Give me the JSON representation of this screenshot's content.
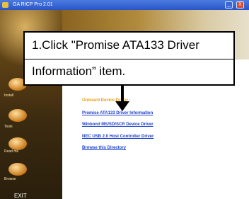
{
  "window": {
    "title": "GA RICP Pro 2.01",
    "minimize_glyph": "_",
    "close_glyph": "X"
  },
  "sidebar": {
    "items": [
      {
        "label": "Install",
        "icon": "orb-icon"
      },
      {
        "label": "Tools",
        "icon": "orb-icon"
      },
      {
        "label": "Read me",
        "icon": "orb-icon"
      },
      {
        "label": "Browse",
        "icon": "orb-icon"
      }
    ],
    "exit_label": "EXIT"
  },
  "main": {
    "section_title": "Onboard Device Driver :",
    "items": [
      "Promise ATA133 Driver Information",
      "Winbond MS/SD/SCR Device Driver",
      "NEC USB 2.0 Host Controller Driver",
      "Browse this Directory"
    ]
  },
  "callout": {
    "line1": "1.Click \"Promise ATA133 Driver",
    "line2": "Information” item."
  },
  "colors": {
    "title_bar": "#2a55c8",
    "link": "#1a3fc8",
    "section_title": "#e8a020",
    "sidebar": "#5a3e14"
  }
}
